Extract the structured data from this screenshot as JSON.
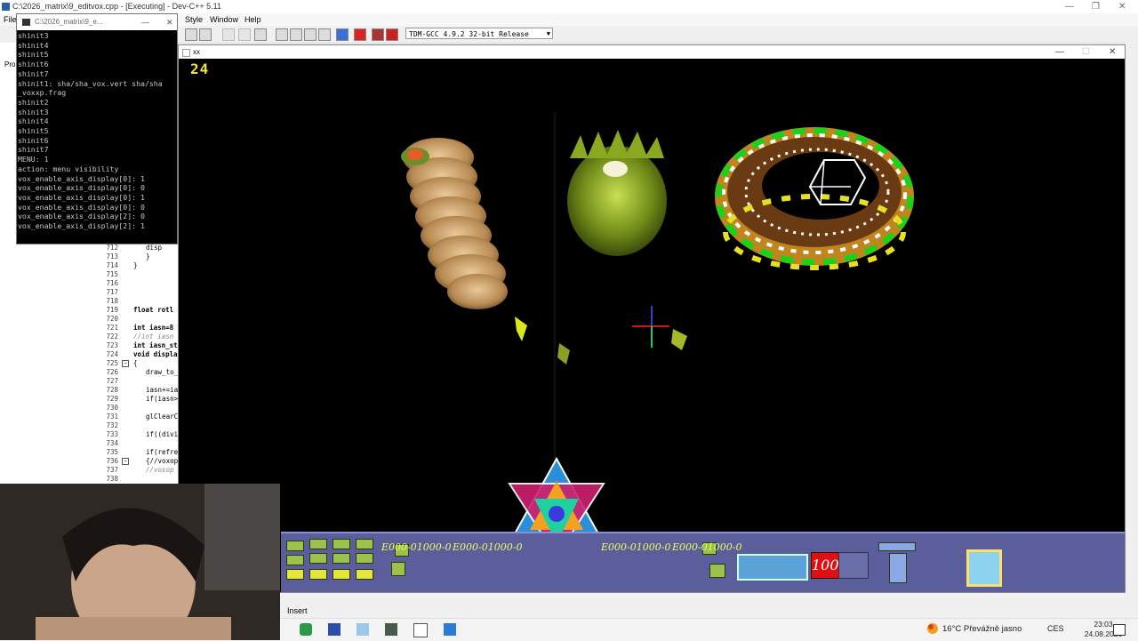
{
  "ide": {
    "title": "C:\\2026_matrix\\9_editvox.cpp - [Executing] - Dev-C++ 5.11",
    "menu": {
      "file": "File",
      "astyle": "Style",
      "window": "Window",
      "help": "Help"
    },
    "compiler": "TDM-GCC 4.9.2 32-bit Release",
    "left_panel_label": "Pro",
    "status_mode": "Insert",
    "code_lines": [
      {
        "n": "712",
        "t": "disp"
      },
      {
        "n": "713",
        "t": "}"
      },
      {
        "n": "714",
        "t": "}"
      },
      {
        "n": "715",
        "t": ""
      },
      {
        "n": "716",
        "t": ""
      },
      {
        "n": "717",
        "t": ""
      },
      {
        "n": "718",
        "t": ""
      },
      {
        "n": "719",
        "t": "float rotl"
      },
      {
        "n": "720",
        "t": ""
      },
      {
        "n": "721",
        "t": "int iasn=8"
      },
      {
        "n": "722",
        "t": "//int iasn"
      },
      {
        "n": "723",
        "t": "int iasn_st"
      },
      {
        "n": "724",
        "t": "void displa"
      },
      {
        "n": "725",
        "t": "{"
      },
      {
        "n": "726",
        "t": "draw_to_"
      },
      {
        "n": "727",
        "t": ""
      },
      {
        "n": "728",
        "t": "iasn+=ia"
      },
      {
        "n": "729",
        "t": "if(iasn>"
      },
      {
        "n": "730",
        "t": ""
      },
      {
        "n": "731",
        "t": "glClearC"
      },
      {
        "n": "732",
        "t": ""
      },
      {
        "n": "733",
        "t": "if((divi"
      },
      {
        "n": "734",
        "t": ""
      },
      {
        "n": "735",
        "t": "if(refre"
      },
      {
        "n": "736",
        "t": "{//voxop"
      },
      {
        "n": "737",
        "t": "//voxop"
      },
      {
        "n": "738",
        "t": ""
      }
    ]
  },
  "console": {
    "title": "C:\\2026_matrix\\9_e...",
    "lines": [
      "shinit3",
      "shinit4",
      "shinit5",
      "shinit6",
      "shinit7",
      "shinit1: sha/sha_vox.vert sha/sha",
      "_voxxp.frag",
      "shinit2",
      "shinit3",
      "shinit4",
      "shinit5",
      "shinit6",
      "shinit7",
      "MENU: 1",
      "action: menu visibility",
      "vox_enable_axis_display[0]: 1",
      "vox_enable_axis_display[0]: 0",
      "vox_enable_axis_display[0]: 1",
      "vox_enable_axis_display[0]: 0",
      "vox_enable_axis_display[2]: 0",
      "vox_enable_axis_display[2]: 1"
    ]
  },
  "game": {
    "title": "xx",
    "fps": "24",
    "hud": {
      "coords": [
        "E000-01000-0",
        "E000-01000-0",
        "E000-01000-0",
        "E000-01000-0"
      ],
      "health": "100"
    },
    "colors": {
      "hud_panel": "#5b5e9a",
      "coord_text": "#eaff60",
      "fps": "#f4e23a",
      "health_bg": "#dd1111"
    }
  },
  "taskbar": {
    "weather": "16°C  Převážně jasno",
    "lang": "CES",
    "time": "23:03",
    "date": "24.08.2026",
    "icons": [
      "devcpp-icon",
      "word-icon",
      "paint-icon",
      "explorer-icon",
      "app-icon",
      "app-icon-2"
    ]
  }
}
